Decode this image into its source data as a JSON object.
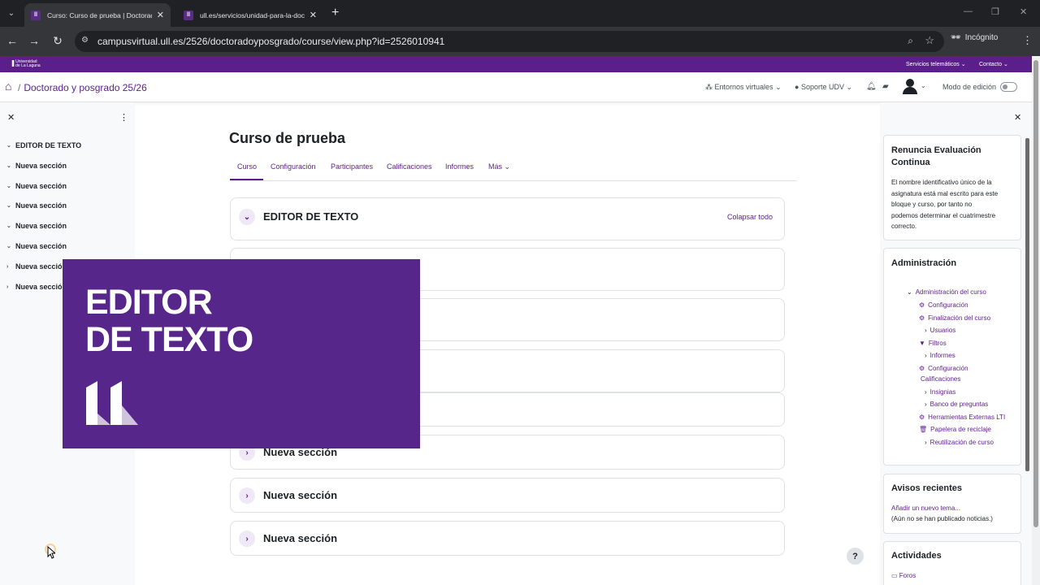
{
  "browser": {
    "tabs": [
      {
        "title": "Curso: Curso de prueba | Doctorado y",
        "active": true
      },
      {
        "title": "ull.es/servicios/unidad-para-la-docen",
        "active": false
      }
    ],
    "url": "campusvirtual.ull.es/2526/doctoradoyposgrado/course/view.php?id=2526010941",
    "incognito_label": "Incógnito"
  },
  "topbar": {
    "logo_text": "Universidad de La Laguna",
    "links": [
      "Servicios telemáticos",
      "Contacto"
    ]
  },
  "nav": {
    "breadcrumb": "Doctorado y posgrado 25/26",
    "entornos": "Entornos virtuales",
    "soporte": "Soporte UDV",
    "edit_mode_label": "Modo de edición"
  },
  "left_drawer": {
    "items": [
      {
        "label": "EDITOR DE TEXTO",
        "expanded": true
      },
      {
        "label": "Nueva sección",
        "expanded": true
      },
      {
        "label": "Nueva sección",
        "expanded": true
      },
      {
        "label": "Nueva sección",
        "expanded": true
      },
      {
        "label": "Nueva sección",
        "expanded": true
      },
      {
        "label": "Nueva sección",
        "expanded": true
      },
      {
        "label": "Nueva sección",
        "expanded": false
      },
      {
        "label": "Nueva sección",
        "expanded": false
      }
    ]
  },
  "course": {
    "title": "Curso de prueba",
    "tabs": [
      "Curso",
      "Configuración",
      "Participantes",
      "Calificaciones",
      "Informes",
      "Más"
    ],
    "collapse_all": "Colapsar todo",
    "sections": [
      "EDITOR DE TEXTO",
      "",
      "",
      "",
      "",
      "Nueva sección",
      "Nueva sección",
      "Nueva sección"
    ]
  },
  "overlay": {
    "line1": "EDITOR",
    "line2": "DE TEXTO"
  },
  "right_drawer": {
    "block1": {
      "title_line1": "Renuncia Evaluación",
      "title_line2": "Continua",
      "text": [
        "El nombre identificativo único de la",
        "asignatura está mal escrito para este",
        "bloque y curso, por tanto no",
        "podemos determinar el cuatrimestre",
        "correcto."
      ]
    },
    "admin": {
      "title": "Administración",
      "root": "Administración del curso",
      "items": [
        {
          "label": "Configuración",
          "icon": "gear-icon"
        },
        {
          "label": "Finalización del curso",
          "icon": "gear-icon"
        },
        {
          "label": "Usuarios",
          "icon": "chevron-right-icon"
        },
        {
          "label": "Filtros",
          "icon": "filter-icon"
        },
        {
          "label": "Informes",
          "icon": "chevron-right-icon"
        },
        {
          "label": "Configuración",
          "label2": "Calificaciones",
          "icon": "gear-icon"
        },
        {
          "label": "Insignias",
          "icon": "chevron-right-icon"
        },
        {
          "label": "Banco de preguntas",
          "icon": "chevron-right-icon"
        },
        {
          "label": "Herramientas Externas LTI",
          "icon": "gear-icon"
        },
        {
          "label": "Papelera de reciclaje",
          "icon": "trash-icon"
        },
        {
          "label": "Reutilización de curso",
          "icon": "chevron-right-icon"
        }
      ]
    },
    "news": {
      "title": "Avisos recientes",
      "link": "Añadir un nuevo tema...",
      "empty": "(Aún no se han publicado noticias.)"
    },
    "activities": {
      "title": "Actividades",
      "first": "Foros"
    }
  },
  "help": "?"
}
